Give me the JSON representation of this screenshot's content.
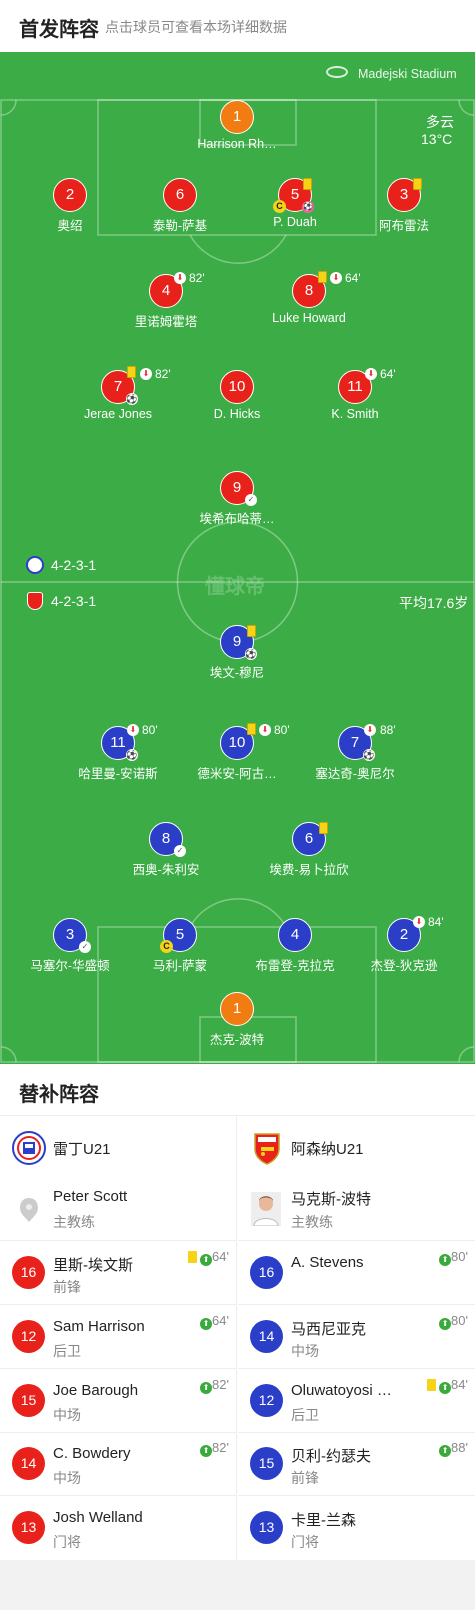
{
  "header": {
    "title": "首发阵容",
    "subtitle": "点击球员可查看本场详细数据"
  },
  "field": {
    "stadium": "Madejski Stadium",
    "weather": "多云",
    "temperature": "13°C",
    "watermark": "懂球帝",
    "home_formation": "4-2-3-1",
    "away_formation": "4-2-3-1",
    "avg_age": "平均17.6岁"
  },
  "home_players": [
    {
      "num": "1",
      "name": "Harrison Rh…"
    },
    {
      "num": "2",
      "name": "奥绍"
    },
    {
      "num": "6",
      "name": "泰勒-萨基"
    },
    {
      "num": "5",
      "name": "P. Duah"
    },
    {
      "num": "3",
      "name": "阿布雷法"
    },
    {
      "num": "4",
      "name": "里诺姆霍塔",
      "time": "82'"
    },
    {
      "num": "8",
      "name": "Luke Howard",
      "time": "64'"
    },
    {
      "num": "7",
      "name": "Jerae Jones",
      "time": "82'"
    },
    {
      "num": "10",
      "name": "D. Hicks"
    },
    {
      "num": "11",
      "name": "K. Smith",
      "time": "64'"
    },
    {
      "num": "9",
      "name": "埃希布哈蒂…"
    }
  ],
  "away_players": [
    {
      "num": "9",
      "name": "埃文-穆尼"
    },
    {
      "num": "11",
      "name": "哈里曼-安诺斯",
      "time": "80'"
    },
    {
      "num": "10",
      "name": "德米安-阿古…",
      "time": "80'"
    },
    {
      "num": "7",
      "name": "塞达奇-奥尼尔",
      "time": "88'"
    },
    {
      "num": "8",
      "name": "西奥-朱利安"
    },
    {
      "num": "6",
      "name": "埃费-易卜拉欣"
    },
    {
      "num": "3",
      "name": "马塞尔-华盛顿"
    },
    {
      "num": "5",
      "name": "马利-萨蒙"
    },
    {
      "num": "4",
      "name": "布雷登-克拉克"
    },
    {
      "num": "2",
      "name": "杰登-狄克逊",
      "time": "84'"
    },
    {
      "num": "1",
      "name": "杰克-波特"
    }
  ],
  "subs": {
    "title": "替补阵容",
    "home": {
      "team": "雷丁U21",
      "coach": {
        "name": "Peter Scott",
        "role": "主教练"
      },
      "players": [
        {
          "num": "16",
          "name": "里斯-埃文斯",
          "pos": "前锋",
          "time": "64'"
        },
        {
          "num": "12",
          "name": "Sam Harrison",
          "pos": "后卫",
          "time": "64'"
        },
        {
          "num": "15",
          "name": "Joe Barough",
          "pos": "中场",
          "time": "82'"
        },
        {
          "num": "14",
          "name": "C. Bowdery",
          "pos": "中场",
          "time": "82'"
        },
        {
          "num": "13",
          "name": "Josh Welland",
          "pos": "门将",
          "time": ""
        }
      ]
    },
    "away": {
      "team": "阿森纳U21",
      "coach": {
        "name": "马克斯-波特",
        "role": "主教练"
      },
      "players": [
        {
          "num": "16",
          "name": "A. Stevens",
          "pos": "",
          "time": "80'"
        },
        {
          "num": "14",
          "name": "马西尼亚克",
          "pos": "中场",
          "time": "80'"
        },
        {
          "num": "12",
          "name": "Oluwatoyosi …",
          "pos": "后卫",
          "time": "84'"
        },
        {
          "num": "15",
          "name": "贝利-约瑟夫",
          "pos": "前锋",
          "time": "88'"
        },
        {
          "num": "13",
          "name": "卡里-兰森",
          "pos": "门将",
          "time": ""
        }
      ]
    }
  },
  "colors": {
    "pitch": "#3cad46",
    "home": "#e8221a",
    "away": "#2b3ec8",
    "keeper": "#f07c12"
  }
}
